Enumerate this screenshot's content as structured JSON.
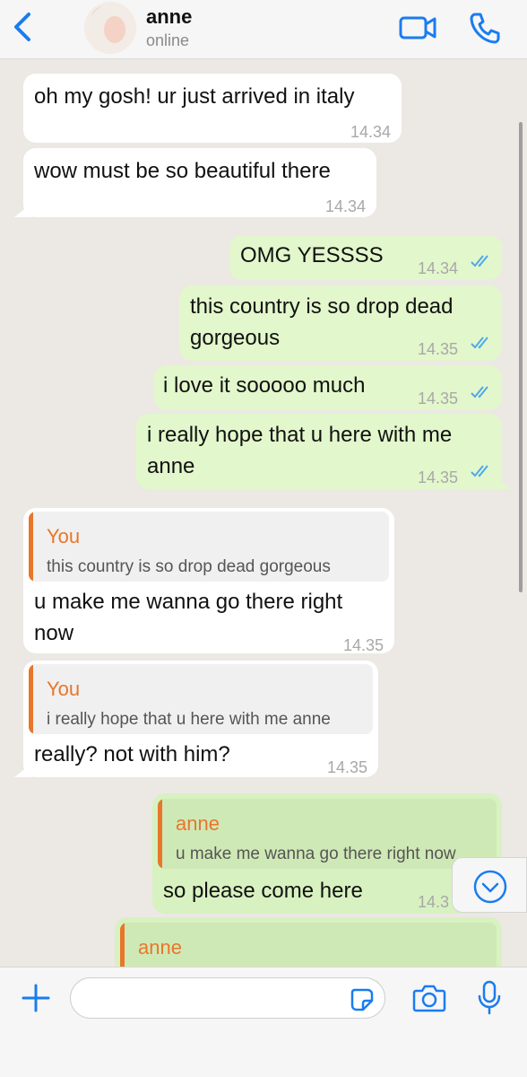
{
  "header": {
    "contact_name": "anne",
    "status": "online",
    "back_icon": "chevron-left-icon",
    "video_icon": "video-camera-icon",
    "call_icon": "phone-icon"
  },
  "messages": [
    {
      "direction": "incoming",
      "text": "oh my gosh! ur just arrived in italy",
      "time": "14.34"
    },
    {
      "direction": "incoming",
      "text": "wow must be so beautiful there",
      "time": "14.34"
    },
    {
      "direction": "outgoing",
      "text": "OMG YESSSS",
      "time": "14.34",
      "read": true
    },
    {
      "direction": "outgoing",
      "text": "this country is so drop dead gorgeous",
      "line1": "this country is so drop dead",
      "line2": "gorgeous",
      "time": "14.35",
      "read": true
    },
    {
      "direction": "outgoing",
      "text": "i love it sooooo much",
      "time": "14.35",
      "read": true
    },
    {
      "direction": "outgoing",
      "text": "i really hope that u here with me anne",
      "line1": "i really hope that u here with me",
      "line2": "anne",
      "time": "14.35",
      "read": true
    },
    {
      "direction": "incoming",
      "reply_to": {
        "author": "You",
        "text": "this country is so drop dead gorgeous"
      },
      "text": "u make me wanna go there right now",
      "line1": "u make me wanna go there right",
      "line2": "now",
      "time": "14.35"
    },
    {
      "direction": "incoming",
      "reply_to": {
        "author": "You",
        "text": "i really hope that u here with me anne"
      },
      "text": "really? not with him?",
      "time": "14.35"
    },
    {
      "direction": "outgoing",
      "reply_to": {
        "author": "anne",
        "text": "u make me wanna go there right now"
      },
      "text": "so please come here",
      "time": "14.3"
    },
    {
      "direction": "outgoing",
      "reply_to": {
        "author": "anne",
        "text": ""
      },
      "text": ""
    }
  ],
  "scroll_down_icon": "chevron-down-circle-icon",
  "composer": {
    "placeholder": "",
    "plus_icon": "plus-icon",
    "sticker_icon": "sticker-icon",
    "camera_icon": "camera-icon",
    "mic_icon": "microphone-icon"
  },
  "colors": {
    "accent": "#1a7cf0",
    "incoming_bubble": "#ffffff",
    "outgoing_bubble": "#e2f7cb",
    "quote_bar": "#e8762b",
    "read_tick": "#4fa9e8",
    "chat_background": "#ece8e4"
  }
}
